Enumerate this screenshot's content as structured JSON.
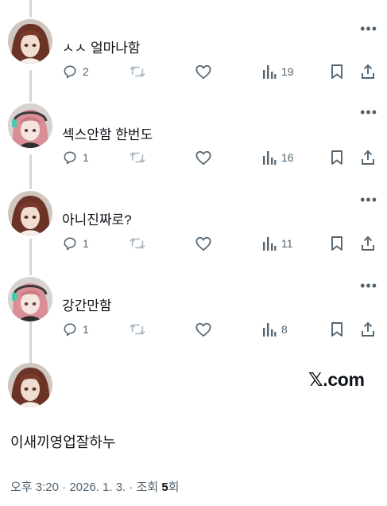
{
  "replies": [
    {
      "text": "ㅅㅅ 얼마나함",
      "replies": "2",
      "views": "19",
      "avatar": "brown-hair"
    },
    {
      "text": "섹스안함 한번도",
      "replies": "1",
      "views": "16",
      "avatar": "pink-hair-headphones"
    },
    {
      "text": "아니진짜로?",
      "replies": "1",
      "views": "11",
      "avatar": "brown-hair"
    },
    {
      "text": "강간만함",
      "replies": "1",
      "views": "8",
      "avatar": "pink-hair-headphones"
    }
  ],
  "more_label": "•••",
  "watermark": "𝕏.com",
  "main_tweet": {
    "text": "이새끼영업잘하누",
    "time": "오후 3:20",
    "separator": " · ",
    "date": "2026. 1. 3.",
    "views_label": "조회 ",
    "views_count": "5",
    "views_suffix": "회"
  },
  "icons": [
    "reply-icon",
    "retweet-icon",
    "like-icon",
    "views-icon",
    "bookmark-icon",
    "share-icon"
  ],
  "colors": {
    "text": "#0f1419",
    "muted": "#536471",
    "thread_line": "#cfd9de",
    "retweet_muted": "#aab8c2"
  }
}
